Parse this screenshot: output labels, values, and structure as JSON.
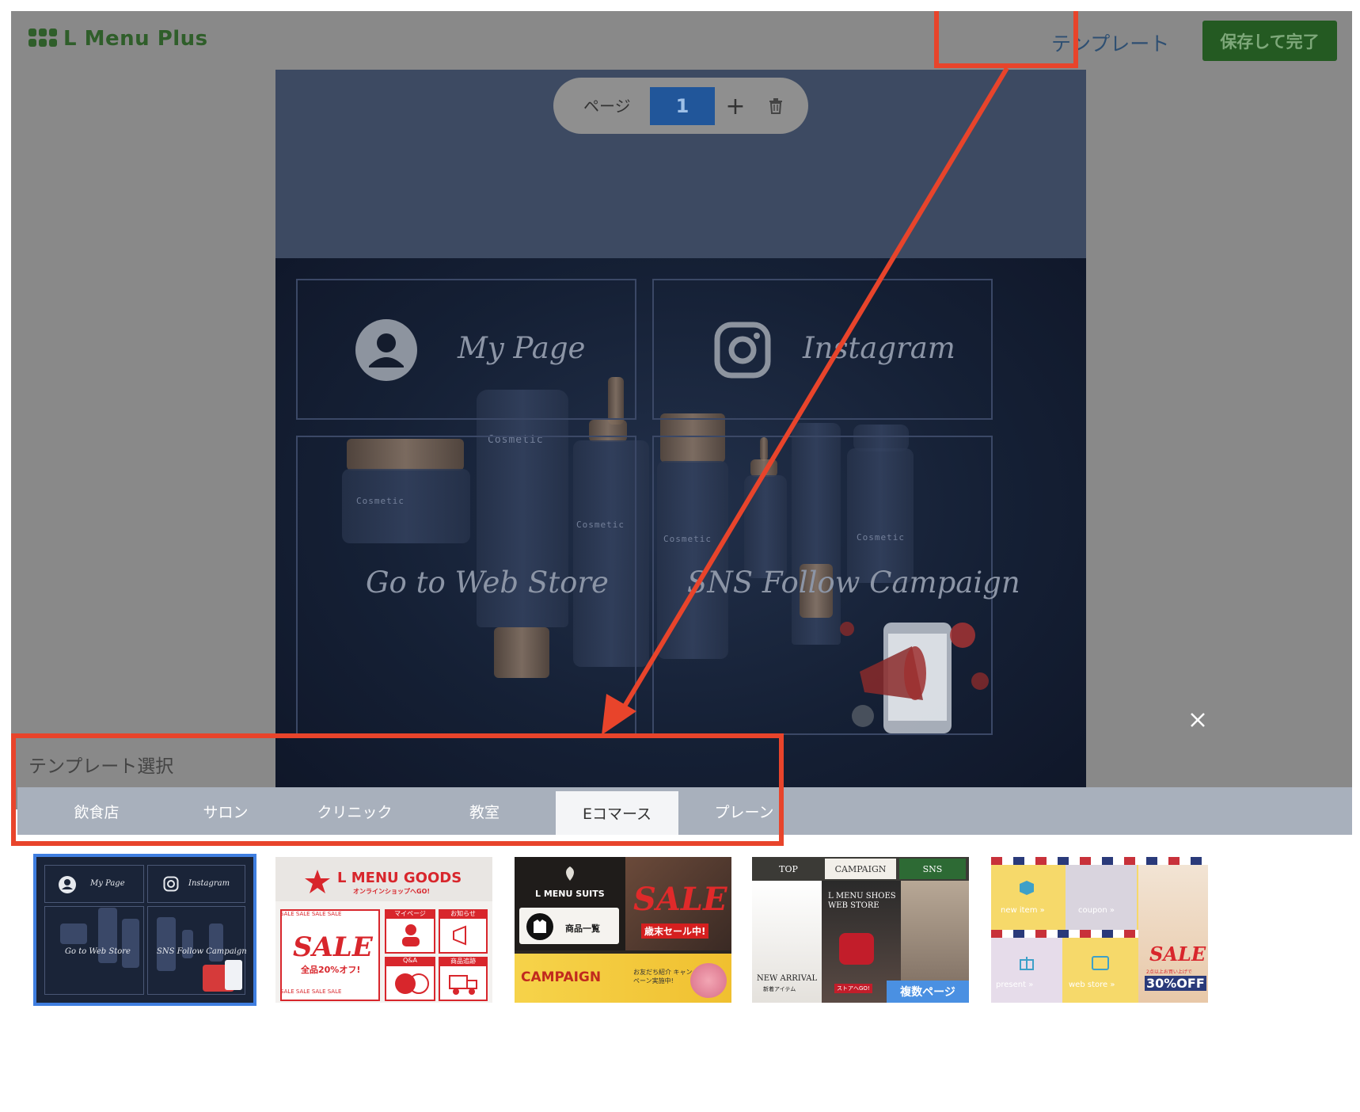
{
  "header": {
    "app_name": "L Menu Plus",
    "template_link": "テンプレート",
    "save_button": "保存して完了"
  },
  "page_controls": {
    "label": "ページ",
    "current_page": "1",
    "add": "+"
  },
  "canvas_tiles": {
    "my_page": "My Page",
    "instagram": "Instagram",
    "web_store": "Go to Web Store",
    "sns_campaign": "SNS Follow Campaign"
  },
  "product_label": "Cosmetic",
  "template_panel": {
    "title": "テンプレート選択",
    "tabs": [
      "飲食店",
      "サロン",
      "クリニック",
      "教室",
      "Eコマース",
      "プレーン"
    ],
    "active_tab": "Eコマース"
  },
  "thumbnails": {
    "t1": {
      "tiles": [
        "My Page",
        "Instagram",
        "Go to Web Store",
        "SNS Follow Campaign"
      ]
    },
    "t2": {
      "brand": "L MENU GOODS",
      "sub": "オンラインショップへGO!",
      "sale": "SALE",
      "sale_sub": "全品20%オフ!",
      "cells": [
        "マイページ",
        "お知らせ",
        "Q&A",
        "商品追跡"
      ],
      "ribbon": "SALE SALE SALE SALE"
    },
    "t3": {
      "brand": "L MENU SUITS",
      "catalog": "商品一覧",
      "sale": "SALE",
      "sale_sub": "歳末セール中!",
      "campaign": "CAMPAIGN",
      "campaign_sub": "お友だち紹介 キャンペーン実施中!"
    },
    "t4": {
      "nav": [
        "TOP",
        "CAMPAIGN",
        "SNS"
      ],
      "brand": "L MENU SHOES WEB STORE",
      "new": "NEW ARRIVAL",
      "new_sub": "新着アイテム",
      "store": "ストアへGO!",
      "badge": "複数ページ"
    },
    "t5": {
      "items": [
        "new item »",
        "coupon »",
        "present »",
        "web store »"
      ],
      "sale": "SALE",
      "sale_sub": "2点以上お買い上げで",
      "off": "30%OFF"
    }
  },
  "colors": {
    "accent_green": "#245a22",
    "annotation_red": "#e8442b",
    "page_blue": "#21569a",
    "selected_outline": "#3f7ee0"
  }
}
